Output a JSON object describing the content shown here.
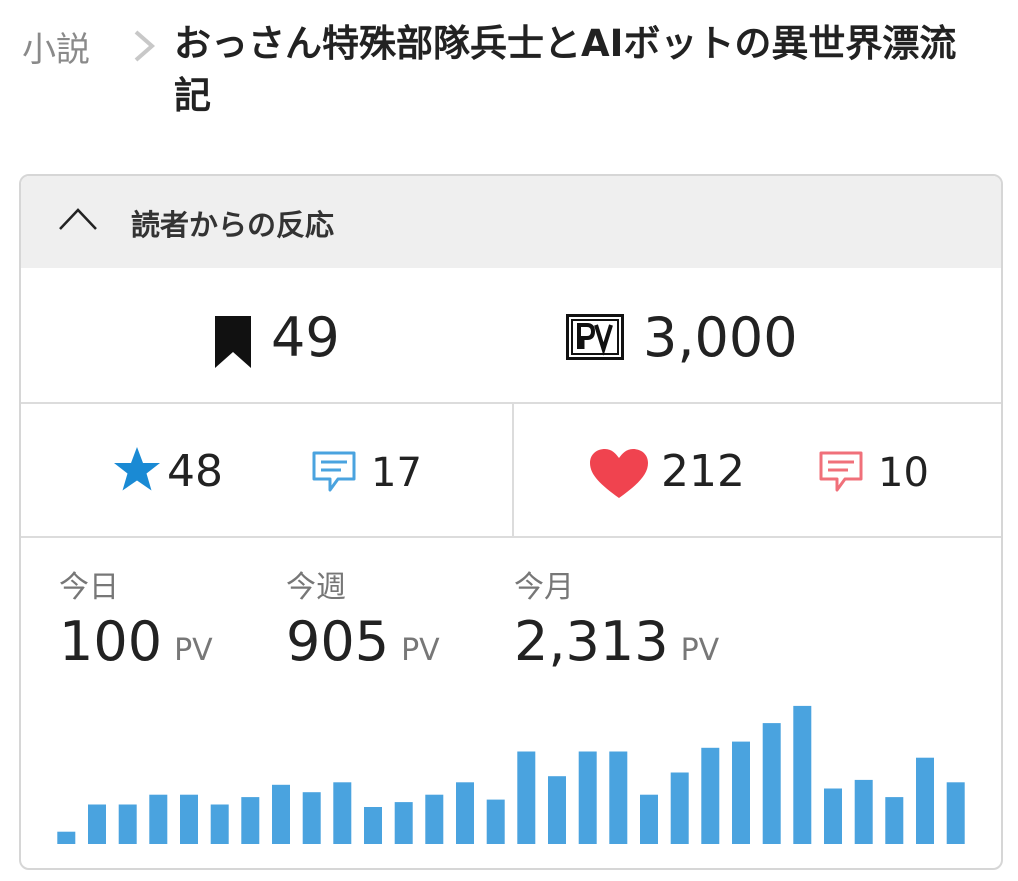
{
  "breadcrumb": {
    "root": "小説",
    "title": "おっさん特殊部隊兵士とAIボットの異世界漂流記"
  },
  "reactions": {
    "heading": "読者からの反応",
    "bookmarks": "49",
    "pv_total": "3,000",
    "stars": "48",
    "star_comments": "17",
    "hearts": "212",
    "heart_comments": "10"
  },
  "stats": {
    "today_label": "今日",
    "today_value": "100",
    "week_label": "今週",
    "week_value": "905",
    "month_label": "今月",
    "month_value": "2,313",
    "unit": "PV"
  },
  "colors": {
    "bar": "#4aa3df",
    "star": "#1a8ad4",
    "heart": "#f0434f",
    "heart_comment": "#f0707a"
  },
  "icons": [
    "chevron-right-icon",
    "chevron-up-icon",
    "bookmark-icon",
    "pv-icon",
    "star-icon",
    "comment-icon",
    "heart-icon"
  ],
  "chart_data": {
    "type": "bar",
    "values": [
      10,
      32,
      32,
      40,
      40,
      32,
      38,
      48,
      42,
      50,
      30,
      34,
      40,
      50,
      36,
      75,
      55,
      75,
      75,
      40,
      58,
      78,
      83,
      98,
      112,
      45,
      52,
      38,
      70,
      50
    ]
  }
}
